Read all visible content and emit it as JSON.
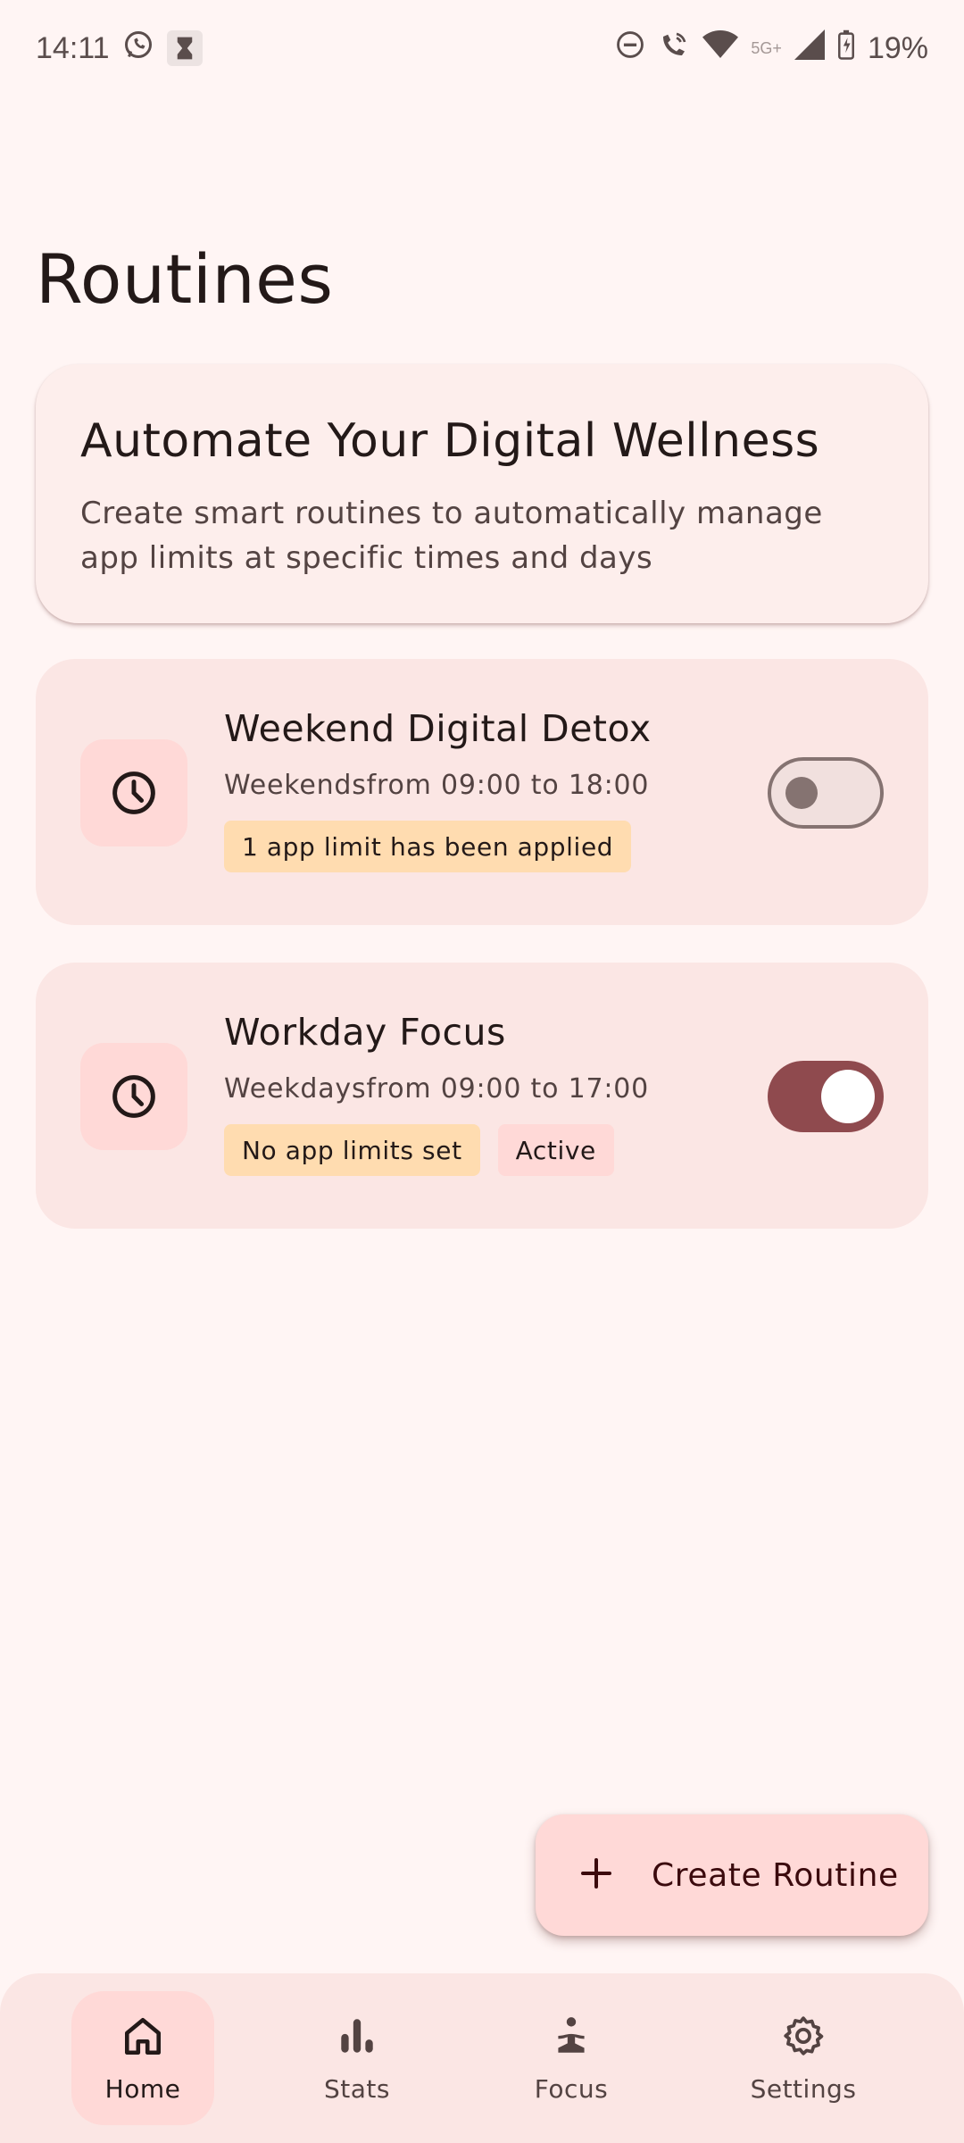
{
  "status_bar": {
    "time": "14:11",
    "network": "5G+",
    "battery": "19%",
    "icons": [
      "whatsapp-icon",
      "hourglass-icon",
      "do-not-disturb-icon",
      "wifi-call-icon",
      "wifi-icon",
      "signal-icon",
      "battery-charging-icon"
    ]
  },
  "page": {
    "title": "Routines"
  },
  "intro": {
    "title": "Automate Your Digital Wellness",
    "description": "Create smart routines to automatically manage app limits at specific times and days"
  },
  "routines": [
    {
      "name": "Weekend Digital Detox",
      "schedule": "Weekendsfrom 09:00 to 18:00",
      "chips": [
        "1 app limit has been applied"
      ],
      "enabled": false,
      "icon": "clock-icon"
    },
    {
      "name": "Workday Focus",
      "schedule": "Weekdaysfrom 09:00 to 17:00",
      "chips": [
        "No app limits set",
        "Active"
      ],
      "enabled": true,
      "icon": "clock-icon"
    }
  ],
  "fab": {
    "label": "Create Routine",
    "icon": "plus-icon"
  },
  "nav": {
    "items": [
      {
        "label": "Home",
        "icon": "home-icon",
        "active": true
      },
      {
        "label": "Stats",
        "icon": "bar-chart-icon",
        "active": false
      },
      {
        "label": "Focus",
        "icon": "meditation-icon",
        "active": false
      },
      {
        "label": "Settings",
        "icon": "gear-icon",
        "active": false
      }
    ]
  },
  "colors": {
    "background": "#fff5f4",
    "card": "#fbe6e4",
    "chip_orange": "#ffdcb0",
    "chip_pink": "#ffd9d7",
    "toggle_on": "#8f4a4e"
  }
}
